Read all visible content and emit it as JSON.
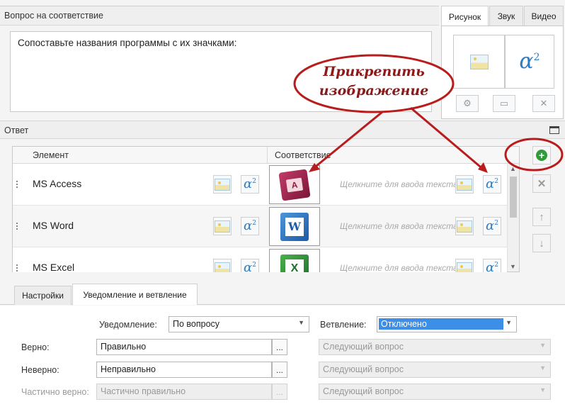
{
  "question_panel": {
    "title": "Вопрос на соответствие",
    "text": "Сопоставьте названия программы с их значками:"
  },
  "media_tabs": [
    "Рисунок",
    "Звук",
    "Видео"
  ],
  "answer_panel": {
    "title": "Ответ",
    "col_element": "Элемент",
    "col_match": "Соответствие",
    "rows": [
      {
        "label": "MS Access",
        "placeholder": "Щелкните для ввода текста",
        "app_icon": "ms-access-icon"
      },
      {
        "label": "MS Word",
        "placeholder": "Щелкните для ввода текста",
        "app_icon": "ms-word-icon"
      },
      {
        "label": "MS Excel",
        "placeholder": "Щелкните для ввода текста",
        "app_icon": "ms-excel-icon"
      }
    ]
  },
  "callout": {
    "line1": "Прикрепить",
    "line2": "изображение"
  },
  "bottom_tabs": [
    "Настройки",
    "Уведомление и ветвление"
  ],
  "feedback": {
    "notification_label": "Уведомление:",
    "notification_value": "По вопросу",
    "branching_label": "Ветвление:",
    "branching_value": "Отключено",
    "correct_label": "Верно:",
    "correct_value": "Правильно",
    "incorrect_label": "Неверно:",
    "incorrect_value": "Неправильно",
    "partial_label": "Частично верно:",
    "partial_value": "Частично правильно",
    "next_question": "Следующий вопрос",
    "dots": "..."
  },
  "colors": {
    "callout_red": "#b81c1c",
    "selection_blue": "#3d8ee6",
    "add_green": "#2f9b3a"
  }
}
